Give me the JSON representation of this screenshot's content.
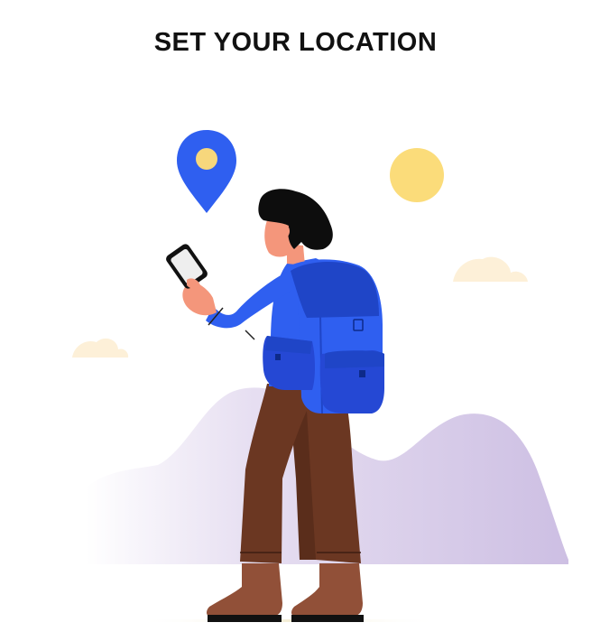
{
  "header": {
    "title": "SET YOUR LOCATION"
  },
  "illustration": {
    "icons": [
      "map-pin-icon",
      "sun-icon",
      "cloud-icon",
      "smartphone-icon",
      "backpack-icon",
      "hiker-figure",
      "hills-background"
    ],
    "colors": {
      "pin_blue": "#2f5ff0",
      "pin_dot": "#f7d77c",
      "sun": "#fbdc7a",
      "cloud": "#fdf0d8",
      "hill": "#d3c8e6",
      "backpack_main": "#2f5ff0",
      "backpack_dark": "#1f45c7",
      "pants": "#6b3722",
      "hair": "#0d0d0d",
      "skin": "#f4967b",
      "shoe": "#915038"
    }
  }
}
